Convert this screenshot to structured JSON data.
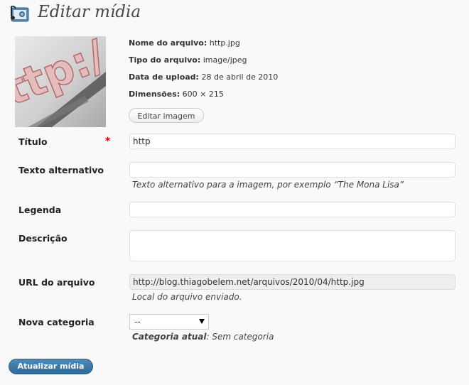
{
  "header": {
    "title": "Editar mídia",
    "icon": "media-music-photo-icon"
  },
  "file_info": {
    "filename_label": "Nome do arquivo:",
    "filename": "http.jpg",
    "type_label": "Tipo do arquivo:",
    "type": "image/jpeg",
    "upload_label": "Data de upload:",
    "upload_date": "28 de abril de 2010",
    "dimensions_label": "Dimensões:",
    "dimensions": "600 × 215",
    "edit_button": "Editar imagem",
    "thumbnail_text": "ttp:/"
  },
  "form": {
    "title_label": "Título",
    "required_mark": "*",
    "title_value": "http",
    "alt_label": "Texto alternativo",
    "alt_value": "",
    "alt_help": "Texto alternativo para a imagem, por exemplo “The Mona Lisa”",
    "caption_label": "Legenda",
    "caption_value": "",
    "description_label": "Descrição",
    "description_value": "",
    "url_label": "URL do arquivo",
    "url_value": "http://blog.thiagobelem.net/arquivos/2010/04/http.jpg",
    "url_help": "Local do arquivo enviado.",
    "category_label": "Nova categoria",
    "category_selected": "--",
    "current_category_label": "Categoria atual",
    "current_category_value": ": Sem categoria"
  },
  "submit_button": "Atualizar mídia",
  "colors": {
    "primary_button": "#2e6a99",
    "required": "#dd0000",
    "background": "#f9f9f9"
  }
}
